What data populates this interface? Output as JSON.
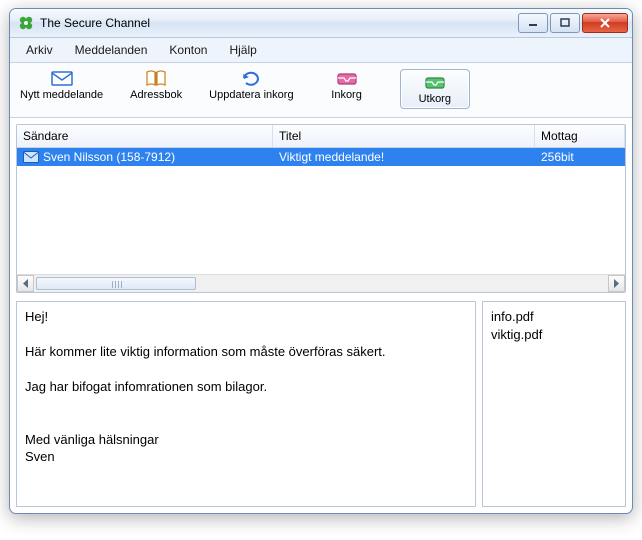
{
  "window": {
    "title": "The Secure Channel"
  },
  "menu": {
    "arkiv": "Arkiv",
    "meddelanden": "Meddelanden",
    "konton": "Konton",
    "hjalp": "Hjälp"
  },
  "toolbar": {
    "nytt": "Nytt meddelande",
    "adressbok": "Adressbok",
    "uppdatera": "Uppdatera inkorg",
    "inkorg": "Inkorg",
    "utkorg": "Utkorg"
  },
  "grid": {
    "headers": {
      "sender": "Sändare",
      "title": "Titel",
      "received": "Mottag"
    },
    "rows": [
      {
        "sender": "Sven Nilsson (158-7912)",
        "title": "Viktigt meddelande!",
        "received": "256bit"
      }
    ]
  },
  "message_body": "Hej!\n\nHär kommer lite viktig information som måste överföras säkert.\n\nJag har bifogat infomrationen som bilagor.\n\n\nMed vänliga hälsningar\nSven",
  "attachments": {
    "a0": "info.pdf",
    "a1": "viktig.pdf"
  }
}
